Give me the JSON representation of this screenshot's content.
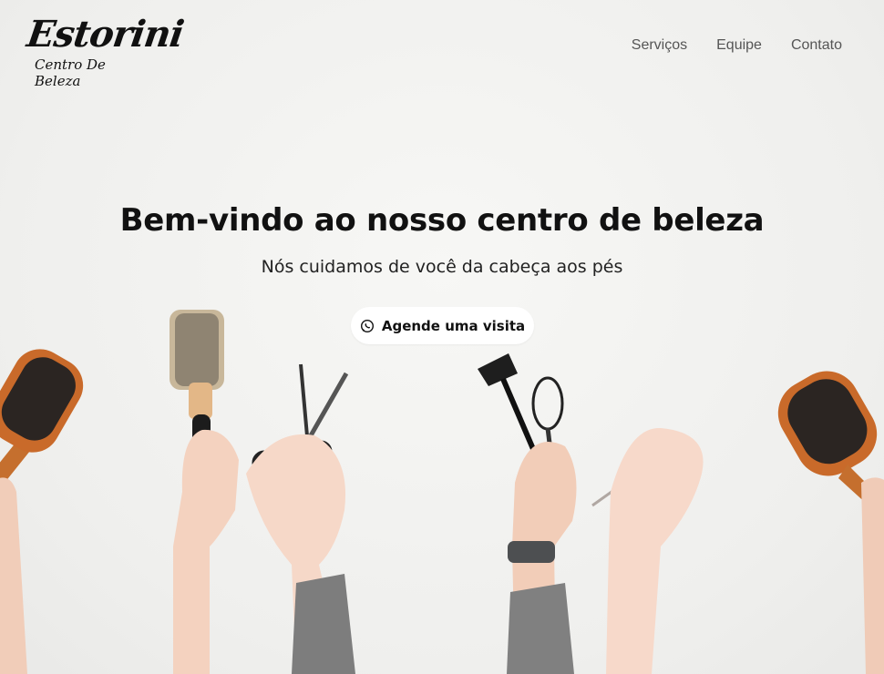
{
  "brand": {
    "name": "Estorini",
    "tagline": "Centro De Beleza"
  },
  "nav": {
    "items": [
      {
        "label": "Serviços"
      },
      {
        "label": "Equipe"
      },
      {
        "label": "Contato"
      }
    ]
  },
  "hero": {
    "title": "Bem-vindo ao nosso centro de beleza",
    "subtitle": "Nós cuidamos de você da cabeça aos pés",
    "cta_label": "Agende uma visita",
    "cta_icon": "whatsapp-icon"
  },
  "colors": {
    "background": "#f3f3f1",
    "text": "#111111",
    "button": "#ffffff"
  }
}
